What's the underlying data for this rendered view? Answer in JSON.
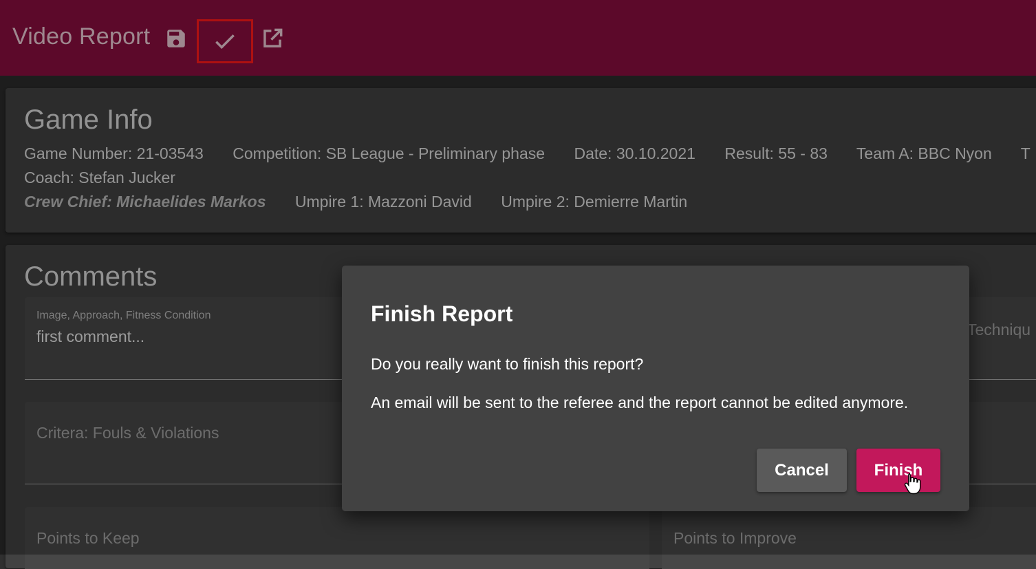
{
  "app": {
    "title": "Video Report",
    "toolbar": {
      "save_icon": "floppy-disk-icon",
      "finish_icon": "check-icon",
      "open_icon": "open-in-new-icon"
    },
    "bar_color": "#880e3e"
  },
  "game_info": {
    "title": "Game Info",
    "game_number": "Game Number: 21-03543",
    "competition": "Competition: SB League - Preliminary phase",
    "date": "Date: 30.10.2021",
    "result": "Result: 55 - 83",
    "team_a": "Team A: BBC Nyon",
    "team_b_partial": "T",
    "coach": "Coach: Stefan Jucker",
    "crew_chief": "Crew Chief: Michaelides Markos",
    "umpire1": "Umpire 1: Mazzoni David",
    "umpire2": "Umpire 2: Demierre Martin"
  },
  "comments": {
    "title": "Comments",
    "fields": {
      "image": {
        "label": "Image, Approach, Fitness Condition",
        "value": "first comment..."
      },
      "technique": {
        "placeholder": "Techniqu"
      },
      "fouls": {
        "placeholder": "Critera: Fouls & Violations"
      },
      "keep": {
        "placeholder": "Points to Keep"
      },
      "improve": {
        "placeholder": "Points to Improve"
      }
    }
  },
  "dialog": {
    "title": "Finish Report",
    "question": "Do you really want to finish this report?",
    "warning": "An email will be sent to the referee and the report cannot be edited anymore.",
    "cancel_label": "Cancel",
    "finish_label": "Finish",
    "finish_color": "#c2185b"
  }
}
